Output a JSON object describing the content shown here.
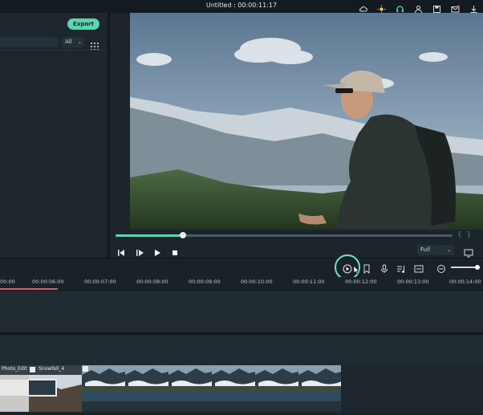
{
  "window": {
    "title": "Untitled : 00:00:11:17"
  },
  "library": {
    "export_label": "Export",
    "filter_value": "All"
  },
  "player": {
    "progress": 0.2,
    "zoom_option": "Full",
    "bracket_in": "{",
    "bracket_out": "}"
  },
  "timeline": {
    "ruler_labels": [
      "00:00",
      "00:00:06:00",
      "00:00:07:00",
      "00:00:08:00",
      "00:00:09:00",
      "00:00:10:00",
      "00:00:11:00",
      "00:00:12:00",
      "00:00:13:00",
      "00:00:14:00"
    ],
    "clips": [
      {
        "label": "Photo_Edit"
      },
      {
        "label": "Snowfall_4"
      }
    ]
  },
  "colors": {
    "accent": "#5dd3b0",
    "highlight_ring": "#6fe3c1",
    "audio_strip": "#2e4b60"
  },
  "icons": {
    "titlebar": [
      "cloud-icon",
      "sun-icon",
      "headset-icon",
      "user-icon",
      "save-icon",
      "mail-icon",
      "download-icon"
    ],
    "player_controls": [
      "prev-frame-icon",
      "step-icon",
      "play-icon",
      "stop-icon"
    ],
    "timeline_tools": [
      "render-icon",
      "marker-icon",
      "mic-icon",
      "audio-mixer-icon",
      "caption-icon",
      "zoom-out-icon"
    ]
  }
}
